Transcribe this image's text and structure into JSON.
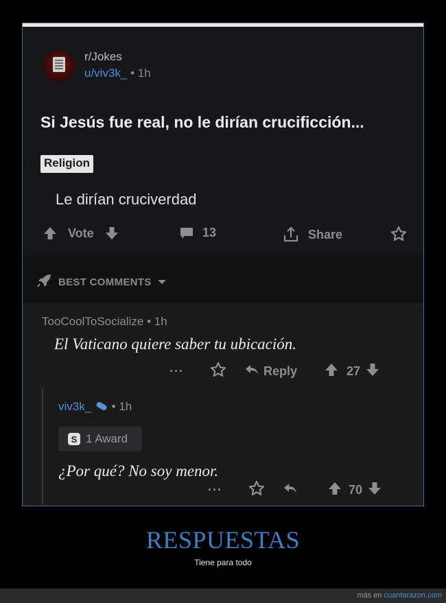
{
  "post": {
    "subreddit": "r/Jokes",
    "username": "u/viv3k_",
    "time": "1h",
    "title": "Si Jesús fue real, no le dirían crucificción...",
    "flair": "Religion",
    "body": "Le dirían cruciverdad",
    "vote_label": "Vote",
    "comment_count": "13",
    "share_label": "Share"
  },
  "best_comments_label": "BEST COMMENTS",
  "comments": [
    {
      "author": "TooCoolToSocialize",
      "time": "1h",
      "text": "El Vaticano quiere saber tu ubicación.",
      "more": "···",
      "reply_label": "Reply",
      "score": "27"
    },
    {
      "author": "viv3k_",
      "time": "1h",
      "award": "1 Award",
      "text": "¿Por qué? No soy menor.",
      "more": "···",
      "score": "70"
    }
  ],
  "caption": {
    "title": "RESPUESTAS",
    "subtitle": "Tiene para todo"
  },
  "footer": {
    "prefix": "más en",
    "link": "cuantarazon.com"
  },
  "colors": {
    "accent_blue": "#3b7fc4",
    "username_blue": "#4a8ed8",
    "icon_gray": "#8e8e8e"
  }
}
